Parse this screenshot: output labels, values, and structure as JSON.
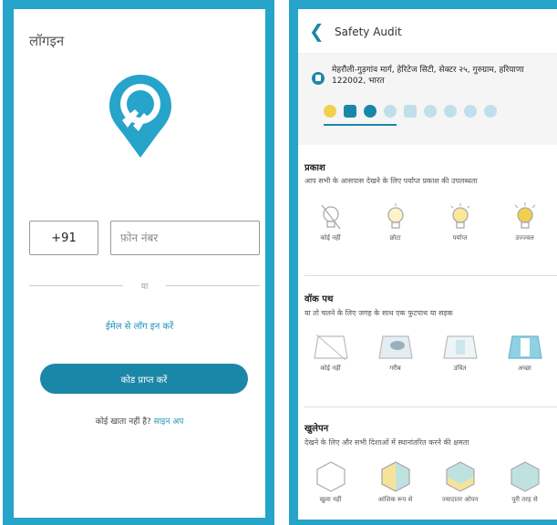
{
  "login": {
    "title": "लॉगइन",
    "country_code": "+91",
    "phone_placeholder": "फ़ोन नंबर",
    "or_text": "या",
    "email_login": "ईमेल से लॉग इन करें",
    "get_code_button": "कोड प्राप्त करें",
    "no_account": "कोई खाता नहीं है?",
    "signup_link": "साइन अप"
  },
  "audit": {
    "title": "Safety Audit",
    "address": "मेहरौली-गुड़गांव मार्ग, हेरिटेज सिटी, सेक्टर २५, गुरुग्राम, हरियाणा 122002, भारत",
    "categories": [
      "lightbulb-icon",
      "road-icon",
      "hexagon-icon",
      "people-icon",
      "bus-icon",
      "guard-icon",
      "crowd-icon",
      "family-icon",
      "face-icon"
    ],
    "sections": [
      {
        "title": "प्रकाश",
        "desc": "आप सभी के आसपास देखने के लिए पर्याप्त प्रकाश की उपलब्धता",
        "options": [
          "कोई नहीं",
          "छोटा",
          "पर्याप्त",
          "उज्ज्वल"
        ]
      },
      {
        "title": "वॉक पथ",
        "desc": "या तो चलने के लिए जगह के साथ एक फुटपाथ या सड़क",
        "options": [
          "कोई नहीं",
          "गरीब",
          "उचित",
          "अच्छा"
        ]
      },
      {
        "title": "खुलेपन",
        "desc": "देखने के लिए और सभी दिशाओं में स्थानांतरित करने की क्षमता",
        "options": [
          "खुला नहीं",
          "आंशिक रूप से",
          "ज्यादातर ओपन",
          "पूरी तरह से"
        ]
      }
    ]
  },
  "colors": {
    "brand": "#26a4c9",
    "button": "#1b87a8",
    "link": "#1b8fbc"
  }
}
